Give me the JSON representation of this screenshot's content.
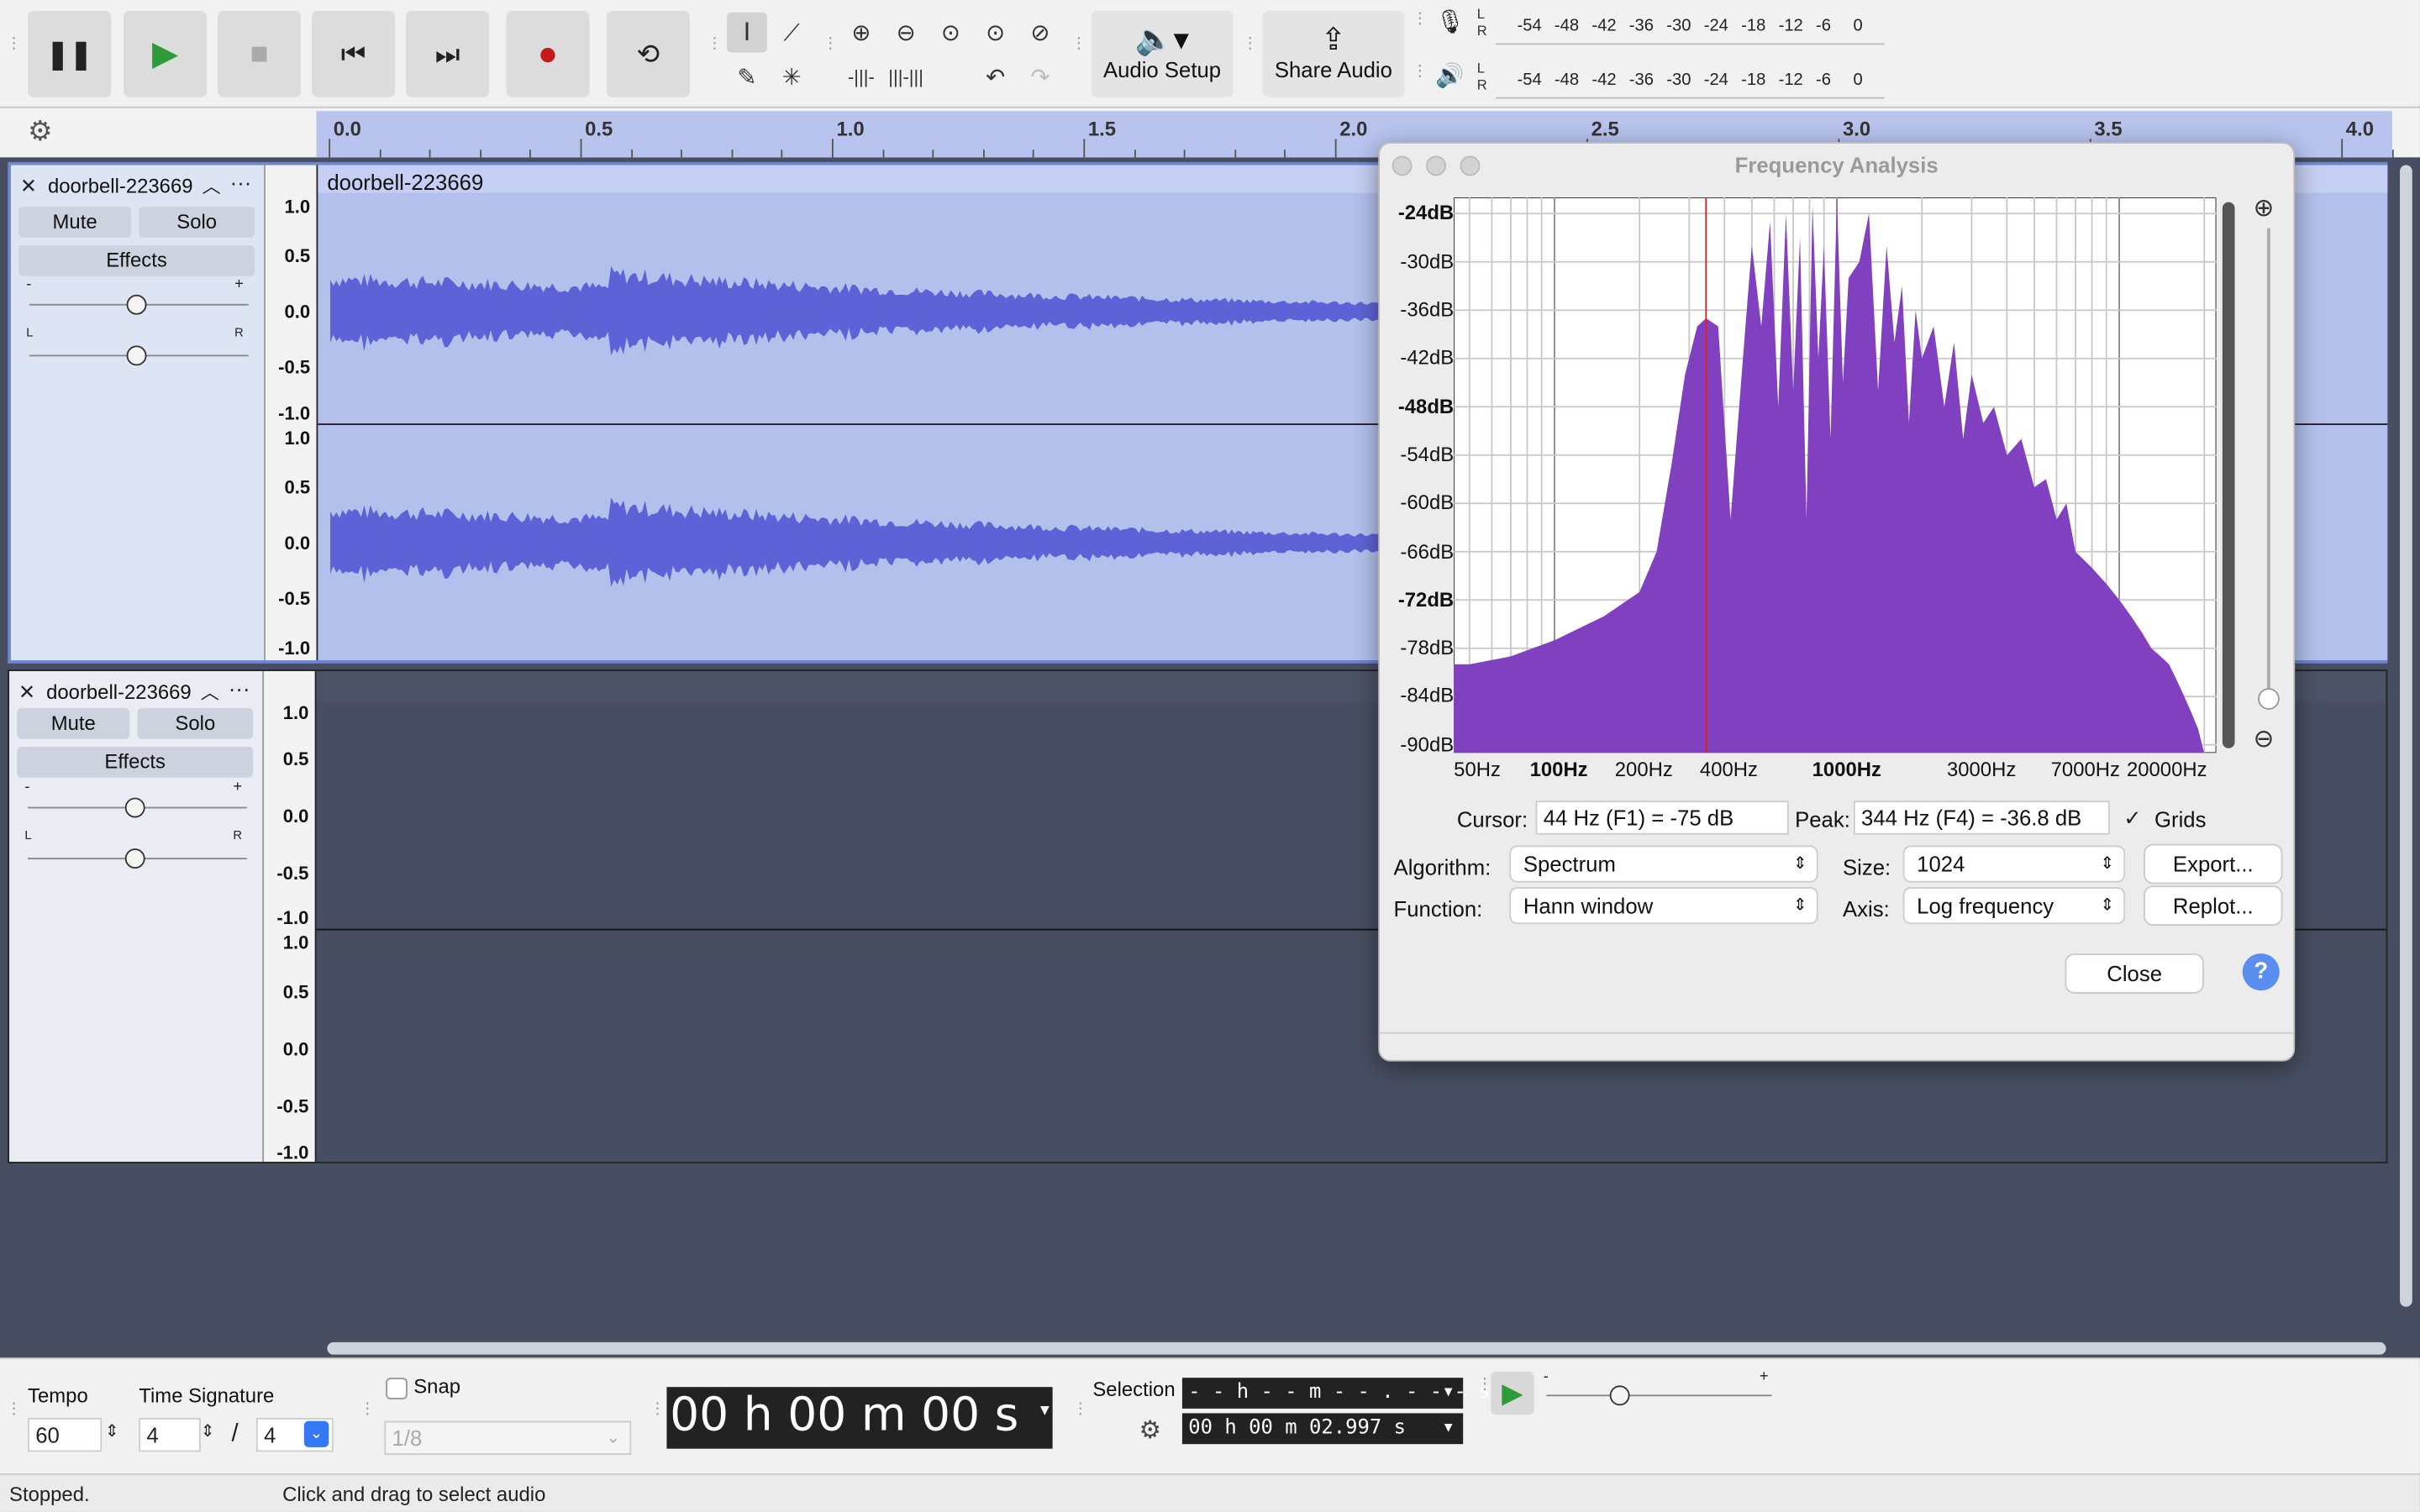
{
  "toolbar": {
    "audio_setup": "Audio Setup",
    "share_audio": "Share Audio",
    "meter_ticks": [
      "-54",
      "-48",
      "-42",
      "-36",
      "-30",
      "-24",
      "-18",
      "-12",
      "-6",
      "0"
    ],
    "meter_lr": [
      "L",
      "R"
    ]
  },
  "ruler": {
    "ticks": [
      "0.0",
      "0.5",
      "1.0",
      "1.5",
      "2.0",
      "2.5",
      "3.0",
      "3.5",
      "4.0"
    ]
  },
  "tracks": [
    {
      "name": "doorbell-223669",
      "clip_name": "doorbell-223669",
      "mute": "Mute",
      "solo": "Solo",
      "effects": "Effects",
      "scale": [
        "1.0",
        "0.5",
        "0.0",
        "-0.5",
        "-1.0"
      ],
      "selected": true
    },
    {
      "name": "doorbell-223669",
      "mute": "Mute",
      "solo": "Solo",
      "effects": "Effects",
      "scale": [
        "1.0",
        "0.5",
        "0.0",
        "-0.5",
        "-1.0"
      ],
      "selected": false
    }
  ],
  "slider_marks": {
    "minus": "-",
    "plus": "+",
    "left": "L",
    "right": "R"
  },
  "dialog": {
    "title": "Frequency Analysis",
    "y_labels": [
      "-24dB",
      "-30dB",
      "-36dB",
      "-42dB",
      "-48dB",
      "-54dB",
      "-60dB",
      "-66dB",
      "-72dB",
      "-78dB",
      "-84dB",
      "-90dB"
    ],
    "x_labels": [
      "50Hz",
      "100Hz",
      "200Hz",
      "400Hz",
      "1000Hz",
      "3000Hz",
      "7000Hz",
      "20000Hz"
    ],
    "cursor_label": "Cursor:",
    "cursor_value": "44 Hz (F1) = -75 dB",
    "peak_label": "Peak:",
    "peak_value": "344 Hz (F4) = -36.8 dB",
    "grids_label": "Grids",
    "grids_checked": true,
    "algorithm_label": "Algorithm:",
    "algorithm_value": "Spectrum",
    "size_label": "Size:",
    "size_value": "1024",
    "function_label": "Function:",
    "function_value": "Hann window",
    "axis_label": "Axis:",
    "axis_value": "Log frequency",
    "export_button": "Export...",
    "replot_button": "Replot...",
    "close_button": "Close",
    "help_button": "?",
    "spectrum_color": "#8040c0"
  },
  "chart_data": {
    "type": "area",
    "title": "",
    "xlabel": "",
    "ylabel": "",
    "x_scale": "log",
    "xlim": [
      44,
      22050
    ],
    "ylim": [
      -91,
      -22
    ],
    "grid": true,
    "cursor_hz": 344,
    "x": [
      44,
      50,
      70,
      100,
      150,
      200,
      230,
      260,
      290,
      320,
      344,
      380,
      420,
      460,
      500,
      540,
      580,
      620,
      660,
      700,
      740,
      780,
      820,
      860,
      900,
      950,
      1000,
      1050,
      1100,
      1200,
      1300,
      1400,
      1500,
      1600,
      1700,
      1800,
      1900,
      2000,
      2200,
      2400,
      2600,
      2800,
      3000,
      3300,
      3600,
      4000,
      4500,
      5000,
      5500,
      6000,
      6500,
      7000,
      8000,
      9000,
      10000,
      11000,
      12000,
      13000,
      14000,
      15000,
      16000,
      17000,
      18000,
      19000,
      20000
    ],
    "y": [
      -80,
      -80,
      -79,
      -77,
      -74,
      -71,
      -66,
      -55,
      -44,
      -38,
      -37,
      -38,
      -62,
      -44,
      -28,
      -38,
      -25,
      -48,
      -24,
      -46,
      -27,
      -62,
      -23,
      -42,
      -28,
      -52,
      -22,
      -45,
      -32,
      -30,
      -24,
      -46,
      -28,
      -40,
      -33,
      -50,
      -36,
      -42,
      -38,
      -48,
      -40,
      -52,
      -44,
      -50,
      -48,
      -54,
      -52,
      -58,
      -57,
      -62,
      -60,
      -66,
      -68,
      -70,
      -72,
      -74,
      -76,
      -78,
      -79,
      -80,
      -82,
      -84,
      -86,
      -88,
      -91
    ]
  },
  "bottom": {
    "tempo_label": "Tempo",
    "tempo_value": "60",
    "timesig_label": "Time Signature",
    "timesig_num": "4",
    "timesig_slash": "/",
    "timesig_den": "4",
    "snap_label": "Snap",
    "snap_value": "1/8",
    "time_display": "00 h 00 m 00 s",
    "selection_label": "Selection",
    "selection_start": "- - h - - m - - . - - - s",
    "selection_end": "00 h 00 m 02.997 s",
    "speed_minus": "-",
    "speed_plus": "+"
  },
  "status": {
    "left": "Stopped.",
    "hint": "Click and drag to select audio"
  }
}
